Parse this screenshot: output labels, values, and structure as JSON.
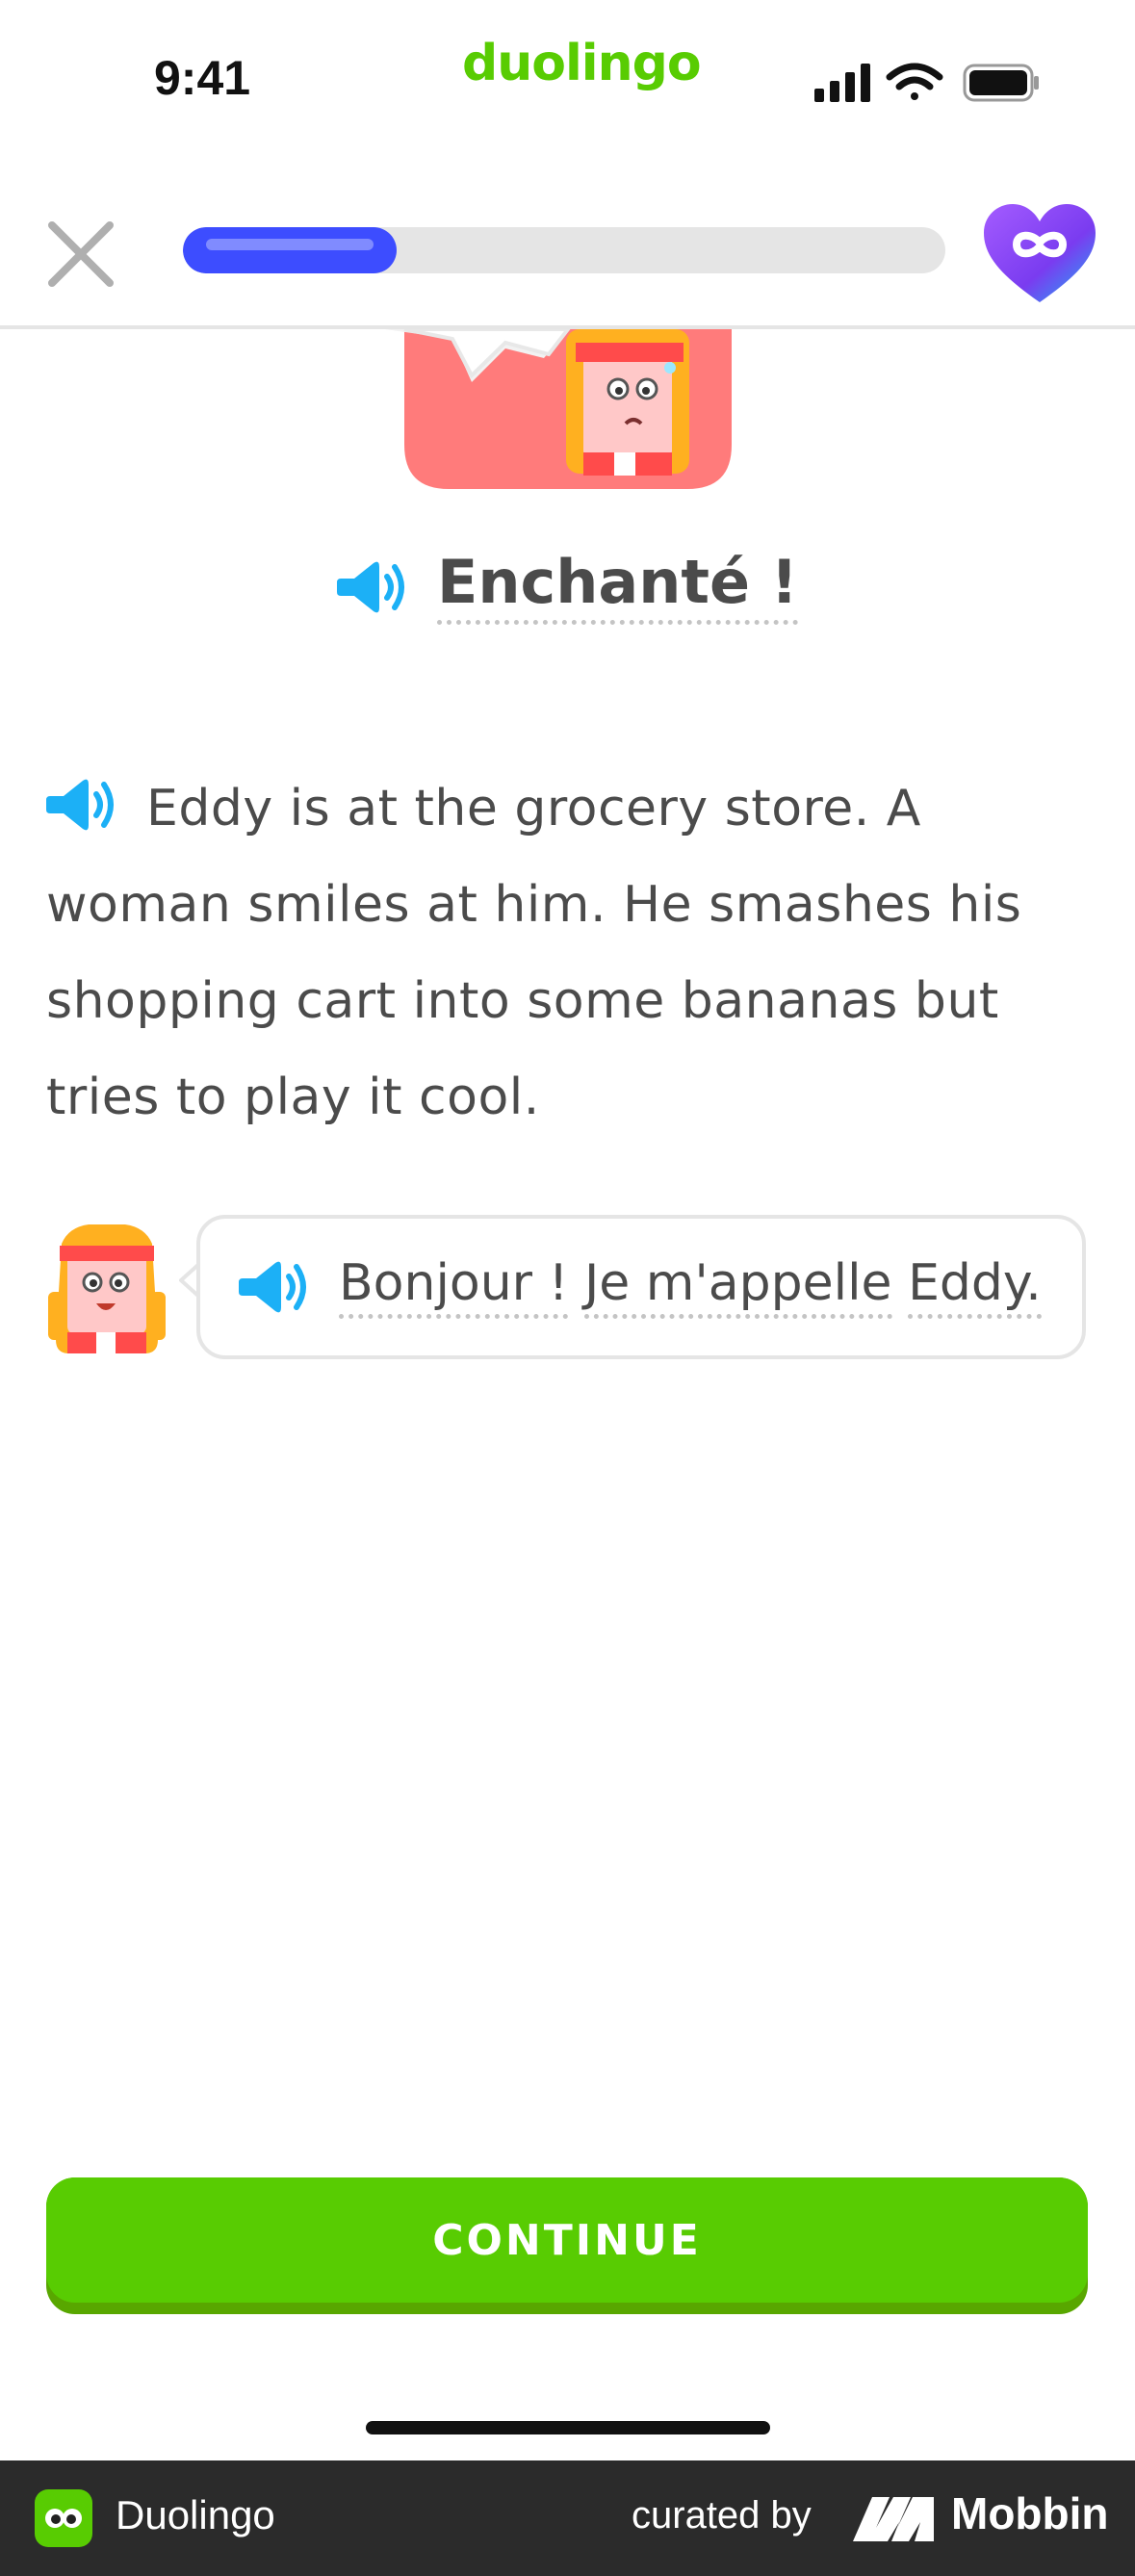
{
  "status_bar": {
    "time": "9:41",
    "brand": "duolingo",
    "icons": [
      "cellular-signal-icon",
      "wifi-icon",
      "battery-icon"
    ]
  },
  "lesson_header": {
    "close_icon": "close-icon",
    "progress_fraction": 0.28,
    "hearts_icon": "infinity-heart-icon"
  },
  "story": {
    "title": "Enchanté !",
    "narrative": "Eddy is at the grocery store. A woman smiles at him. He smashes his shopping cart into some bananas but tries to play it cool.",
    "dialogue": {
      "speaker": "Eddy",
      "words": [
        "Bonjour !",
        "Je m'appelle",
        "Eddy."
      ]
    }
  },
  "continue_button": {
    "label": "CONTINUE"
  },
  "footer": {
    "app_name": "Duolingo",
    "curated_by": "curated by",
    "brand": "Mobbin"
  },
  "colors": {
    "brand_green": "#58cc02",
    "progress_blue": "#3d4dff",
    "speaker_blue": "#1cb0f6",
    "text": "#4b4b4b"
  }
}
